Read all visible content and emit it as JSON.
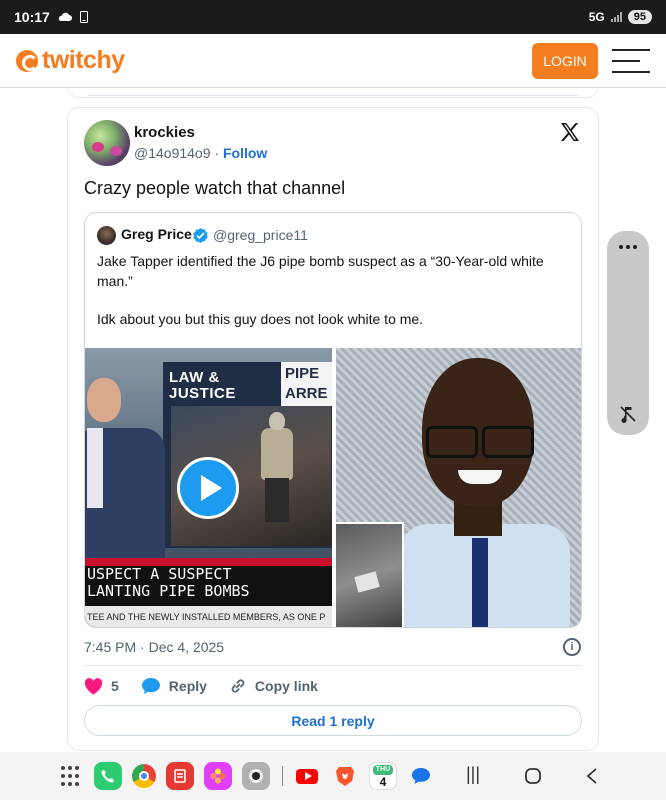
{
  "status_bar": {
    "time": "10:17",
    "network": "5G",
    "battery": "95"
  },
  "header": {
    "logo_text": "twitchy",
    "login_label": "LOGIN"
  },
  "tweet": {
    "author_name": "krockies",
    "author_handle": "@14o914o9",
    "separator": "·",
    "follow_label": "Follow",
    "text": "Crazy people watch that channel",
    "timestamp": "7:45 PM · Dec 4, 2025",
    "likes": "5",
    "reply_label": "Reply",
    "copy_link_label": "Copy link",
    "read_replies_label": "Read 1 reply"
  },
  "quoted": {
    "author_name": "Greg Price",
    "author_handle": "@greg_price11",
    "paragraph1": "Jake Tapper identified the J6 pipe bomb suspect as a “30-Year-old white man.”",
    "paragraph2": "Idk about you but this guy does not look white to me.",
    "media": {
      "panel_line1": "LAW &",
      "panel_line2": "JUSTICE",
      "pipe_line1": "PIPE",
      "pipe_line2": "ARRE",
      "chyron_line1": "USPECT A SUSPECT",
      "chyron_line2": "LANTING PIPE BOMBS",
      "ticker": "TEE AND THE NEWLY INSTALLED MEMBERS, AS ONE P"
    }
  },
  "nav": {
    "calendar_day": "THU",
    "calendar_date": "4"
  },
  "colors": {
    "brand": "#f47d20",
    "link": "#1d6fd1",
    "like": "#f91880",
    "verified": "#1d9bf0"
  }
}
